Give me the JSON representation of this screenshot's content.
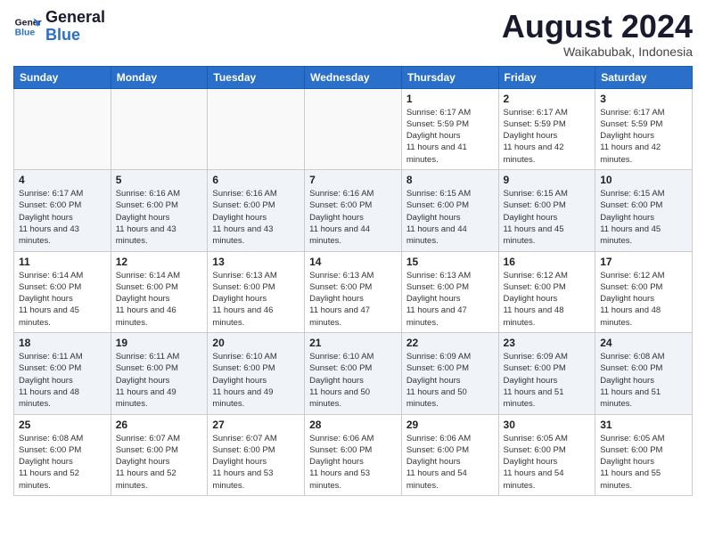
{
  "header": {
    "logo_line1": "General",
    "logo_line2": "Blue",
    "month_title": "August 2024",
    "location": "Waikabubak, Indonesia"
  },
  "days_of_week": [
    "Sunday",
    "Monday",
    "Tuesday",
    "Wednesday",
    "Thursday",
    "Friday",
    "Saturday"
  ],
  "weeks": [
    [
      {
        "day": "",
        "sunrise": "",
        "sunset": "",
        "daylight": "",
        "empty": true
      },
      {
        "day": "",
        "sunrise": "",
        "sunset": "",
        "daylight": "",
        "empty": true
      },
      {
        "day": "",
        "sunrise": "",
        "sunset": "",
        "daylight": "",
        "empty": true
      },
      {
        "day": "",
        "sunrise": "",
        "sunset": "",
        "daylight": "",
        "empty": true
      },
      {
        "day": "1",
        "sunrise": "6:17 AM",
        "sunset": "5:59 PM",
        "daylight": "11 hours and 41 minutes."
      },
      {
        "day": "2",
        "sunrise": "6:17 AM",
        "sunset": "5:59 PM",
        "daylight": "11 hours and 42 minutes."
      },
      {
        "day": "3",
        "sunrise": "6:17 AM",
        "sunset": "5:59 PM",
        "daylight": "11 hours and 42 minutes."
      }
    ],
    [
      {
        "day": "4",
        "sunrise": "6:17 AM",
        "sunset": "6:00 PM",
        "daylight": "11 hours and 43 minutes."
      },
      {
        "day": "5",
        "sunrise": "6:16 AM",
        "sunset": "6:00 PM",
        "daylight": "11 hours and 43 minutes."
      },
      {
        "day": "6",
        "sunrise": "6:16 AM",
        "sunset": "6:00 PM",
        "daylight": "11 hours and 43 minutes."
      },
      {
        "day": "7",
        "sunrise": "6:16 AM",
        "sunset": "6:00 PM",
        "daylight": "11 hours and 44 minutes."
      },
      {
        "day": "8",
        "sunrise": "6:15 AM",
        "sunset": "6:00 PM",
        "daylight": "11 hours and 44 minutes."
      },
      {
        "day": "9",
        "sunrise": "6:15 AM",
        "sunset": "6:00 PM",
        "daylight": "11 hours and 45 minutes."
      },
      {
        "day": "10",
        "sunrise": "6:15 AM",
        "sunset": "6:00 PM",
        "daylight": "11 hours and 45 minutes."
      }
    ],
    [
      {
        "day": "11",
        "sunrise": "6:14 AM",
        "sunset": "6:00 PM",
        "daylight": "11 hours and 45 minutes."
      },
      {
        "day": "12",
        "sunrise": "6:14 AM",
        "sunset": "6:00 PM",
        "daylight": "11 hours and 46 minutes."
      },
      {
        "day": "13",
        "sunrise": "6:13 AM",
        "sunset": "6:00 PM",
        "daylight": "11 hours and 46 minutes."
      },
      {
        "day": "14",
        "sunrise": "6:13 AM",
        "sunset": "6:00 PM",
        "daylight": "11 hours and 47 minutes."
      },
      {
        "day": "15",
        "sunrise": "6:13 AM",
        "sunset": "6:00 PM",
        "daylight": "11 hours and 47 minutes."
      },
      {
        "day": "16",
        "sunrise": "6:12 AM",
        "sunset": "6:00 PM",
        "daylight": "11 hours and 48 minutes."
      },
      {
        "day": "17",
        "sunrise": "6:12 AM",
        "sunset": "6:00 PM",
        "daylight": "11 hours and 48 minutes."
      }
    ],
    [
      {
        "day": "18",
        "sunrise": "6:11 AM",
        "sunset": "6:00 PM",
        "daylight": "11 hours and 48 minutes."
      },
      {
        "day": "19",
        "sunrise": "6:11 AM",
        "sunset": "6:00 PM",
        "daylight": "11 hours and 49 minutes."
      },
      {
        "day": "20",
        "sunrise": "6:10 AM",
        "sunset": "6:00 PM",
        "daylight": "11 hours and 49 minutes."
      },
      {
        "day": "21",
        "sunrise": "6:10 AM",
        "sunset": "6:00 PM",
        "daylight": "11 hours and 50 minutes."
      },
      {
        "day": "22",
        "sunrise": "6:09 AM",
        "sunset": "6:00 PM",
        "daylight": "11 hours and 50 minutes."
      },
      {
        "day": "23",
        "sunrise": "6:09 AM",
        "sunset": "6:00 PM",
        "daylight": "11 hours and 51 minutes."
      },
      {
        "day": "24",
        "sunrise": "6:08 AM",
        "sunset": "6:00 PM",
        "daylight": "11 hours and 51 minutes."
      }
    ],
    [
      {
        "day": "25",
        "sunrise": "6:08 AM",
        "sunset": "6:00 PM",
        "daylight": "11 hours and 52 minutes."
      },
      {
        "day": "26",
        "sunrise": "6:07 AM",
        "sunset": "6:00 PM",
        "daylight": "11 hours and 52 minutes."
      },
      {
        "day": "27",
        "sunrise": "6:07 AM",
        "sunset": "6:00 PM",
        "daylight": "11 hours and 53 minutes."
      },
      {
        "day": "28",
        "sunrise": "6:06 AM",
        "sunset": "6:00 PM",
        "daylight": "11 hours and 53 minutes."
      },
      {
        "day": "29",
        "sunrise": "6:06 AM",
        "sunset": "6:00 PM",
        "daylight": "11 hours and 54 minutes."
      },
      {
        "day": "30",
        "sunrise": "6:05 AM",
        "sunset": "6:00 PM",
        "daylight": "11 hours and 54 minutes."
      },
      {
        "day": "31",
        "sunrise": "6:05 AM",
        "sunset": "6:00 PM",
        "daylight": "11 hours and 55 minutes."
      }
    ]
  ],
  "labels": {
    "sunrise_prefix": "Sunrise: ",
    "sunset_prefix": "Sunset: ",
    "daylight_prefix": "Daylight: "
  }
}
